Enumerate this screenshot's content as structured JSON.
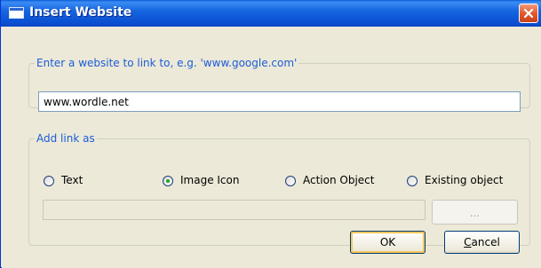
{
  "window": {
    "title": "Insert Website"
  },
  "website_group": {
    "legend": "Enter a website to link to, e.g. 'www.google.com'",
    "url_value": "www.wordle.net"
  },
  "link_group": {
    "legend": "Add link as",
    "options": [
      {
        "label": "Text",
        "selected": false
      },
      {
        "label": "Image Icon",
        "selected": true
      },
      {
        "label": "Action Object",
        "selected": false
      },
      {
        "label": "Existing object",
        "selected": false
      }
    ],
    "browse_label": "..."
  },
  "buttons": {
    "ok_label": "OK",
    "cancel_first_letter": "C",
    "cancel_rest": "ancel"
  },
  "colors": {
    "titlebar": "#0b4fd2",
    "accent_text": "#1c5cd6",
    "radio_selected": "#21a121",
    "dialog_background": "#ece9d8"
  },
  "icons": {
    "title": "window-app-icon",
    "close": "close-icon"
  }
}
